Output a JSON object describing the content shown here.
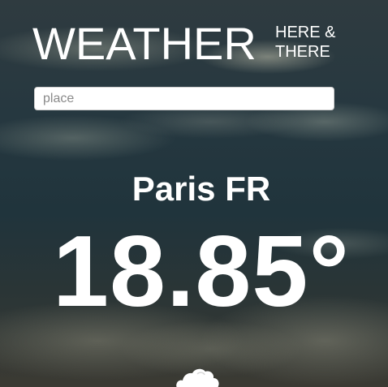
{
  "header": {
    "title_main": "WEATHER",
    "title_sub_line1": "HERE &",
    "title_sub_line2": "THERE"
  },
  "search": {
    "placeholder": "place",
    "value": ""
  },
  "location": {
    "name": "Paris FR"
  },
  "temperature": {
    "display": "18.85°"
  },
  "condition": {
    "icon": "cloud-icon"
  },
  "colors": {
    "text": "#ffffff",
    "input_background": "#ffffff"
  }
}
